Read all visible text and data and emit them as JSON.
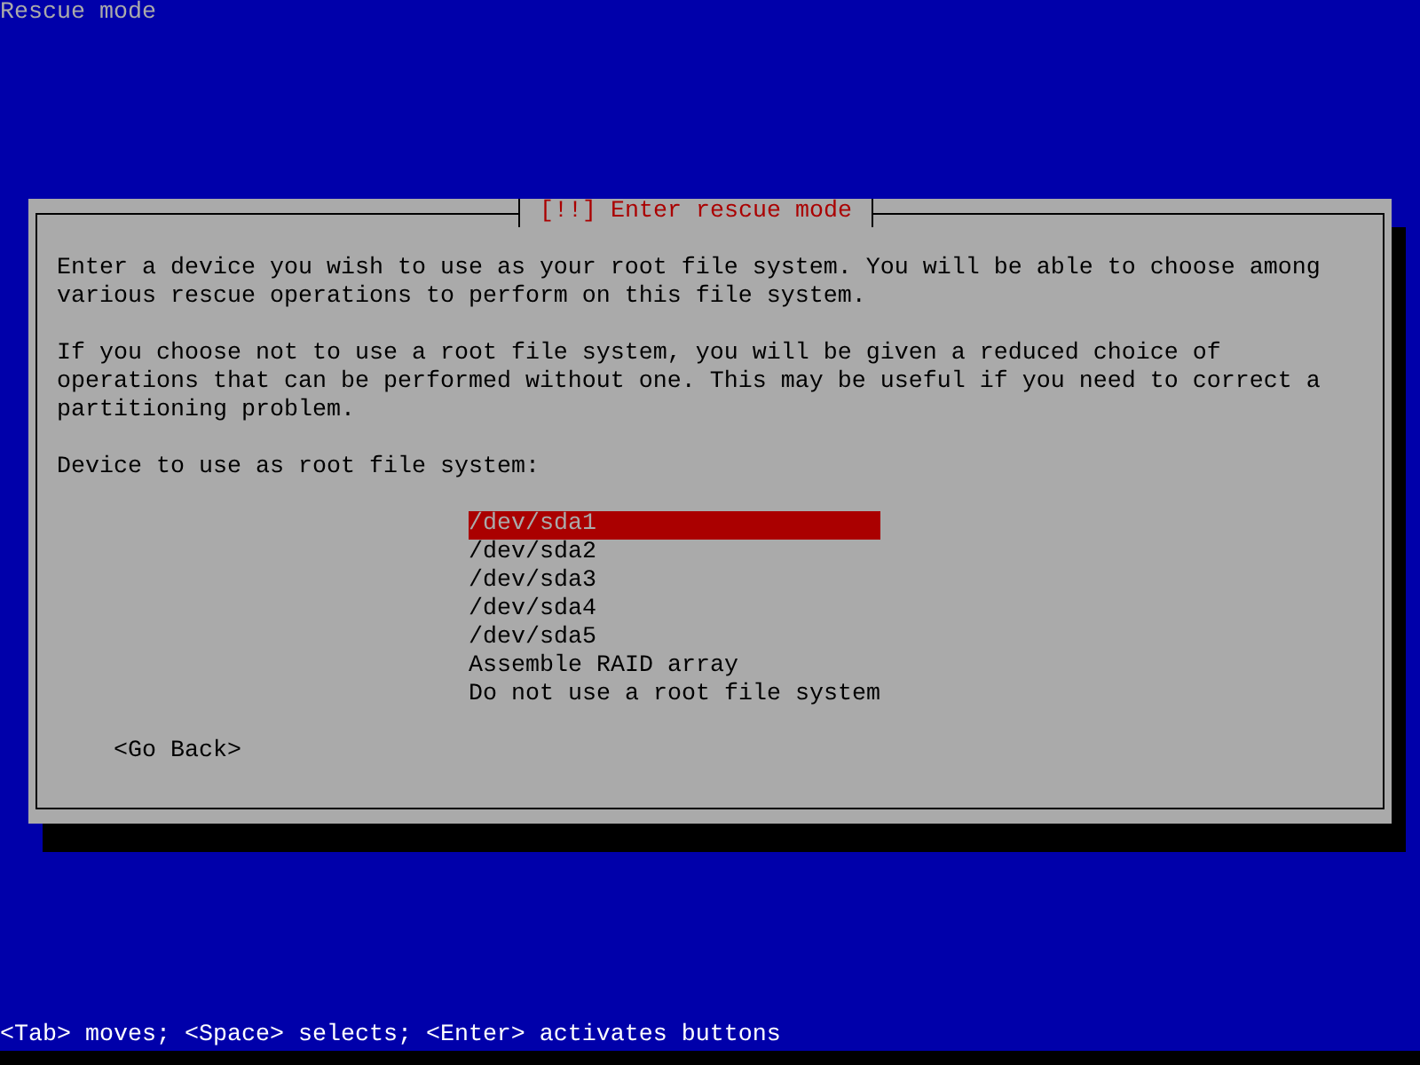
{
  "screen": {
    "title": "Rescue mode"
  },
  "dialog": {
    "title": "[!!] Enter rescue mode",
    "paragraphs": [
      "Enter a device you wish to use as your root file system. You will be able to choose among various rescue operations to perform on this file system.",
      "If you choose not to use a root file system, you will be given a reduced choice of operations that can be performed without one. This may be useful if you need to correct a partitioning problem."
    ],
    "prompt": "Device to use as root file system:",
    "options": [
      {
        "label": "/dev/sda1",
        "selected": true
      },
      {
        "label": "/dev/sda2",
        "selected": false
      },
      {
        "label": "/dev/sda3",
        "selected": false
      },
      {
        "label": "/dev/sda4",
        "selected": false
      },
      {
        "label": "/dev/sda5",
        "selected": false
      },
      {
        "label": "Assemble RAID array",
        "selected": false
      },
      {
        "label": "Do not use a root file system",
        "selected": false
      }
    ],
    "buttons": [
      {
        "label": "<Go Back>"
      }
    ]
  },
  "status_bar": "<Tab> moves; <Space> selects; <Enter> activates buttons"
}
